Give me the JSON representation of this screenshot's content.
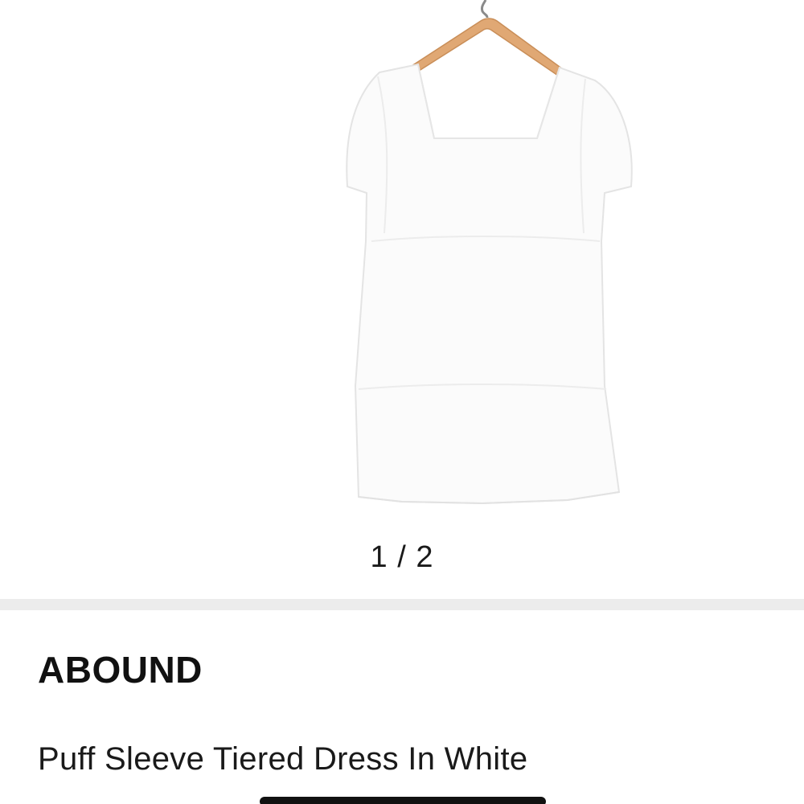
{
  "gallery": {
    "image_description": "white puff sleeve tiered dress on wooden hanger",
    "pager_text": "1 / 2"
  },
  "product": {
    "brand": "ABOUND",
    "name": "Puff Sleeve Tiered Dress In White"
  },
  "colors": {
    "background": "#ffffff",
    "divider": "#ececec",
    "text": "#111111",
    "hanger_wood": "#e0a874"
  }
}
